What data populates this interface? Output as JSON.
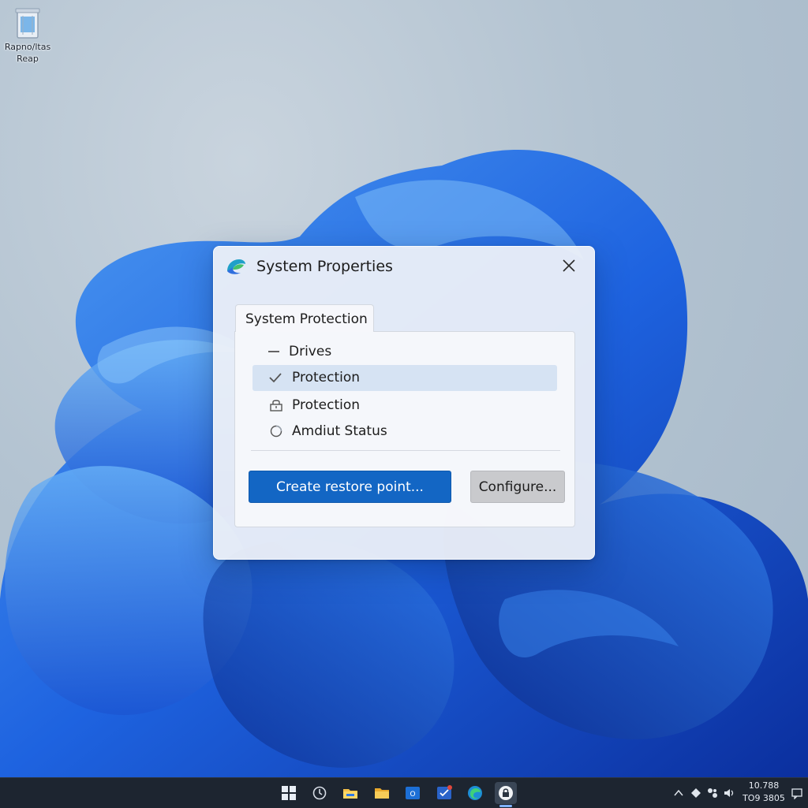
{
  "desktop": {
    "recycle_bin_label": "Rapno/ltas Reap"
  },
  "dialog": {
    "title": "System Properties",
    "tab_label": "System Protection",
    "tree": {
      "drives_label": "Drives",
      "items": [
        {
          "label": "Protection",
          "icon": "checkmark-icon",
          "selected": true
        },
        {
          "label": "Protection",
          "icon": "lock-icon",
          "selected": false
        },
        {
          "label": "Amdiut Status",
          "icon": "circle-status-icon",
          "selected": false
        }
      ]
    },
    "buttons": {
      "create_restore_point": "Create restore point...",
      "configure": "Configure..."
    }
  },
  "taskbar": {
    "apps": [
      "start-icon",
      "search-icon",
      "file-explorer-icon",
      "folder-icon",
      "outlook-icon",
      "to-do-icon",
      "edge-icon",
      "security-icon"
    ],
    "active_app": "security-icon",
    "tray": [
      "chevron-up-icon",
      "network-icon",
      "bluetooth-icon",
      "volume-icon"
    ],
    "time": "10.788",
    "date": "TO9 3805"
  },
  "colors": {
    "accent": "#1366c4",
    "selection": "#d6e3f3",
    "taskbar": "#1d2530"
  }
}
